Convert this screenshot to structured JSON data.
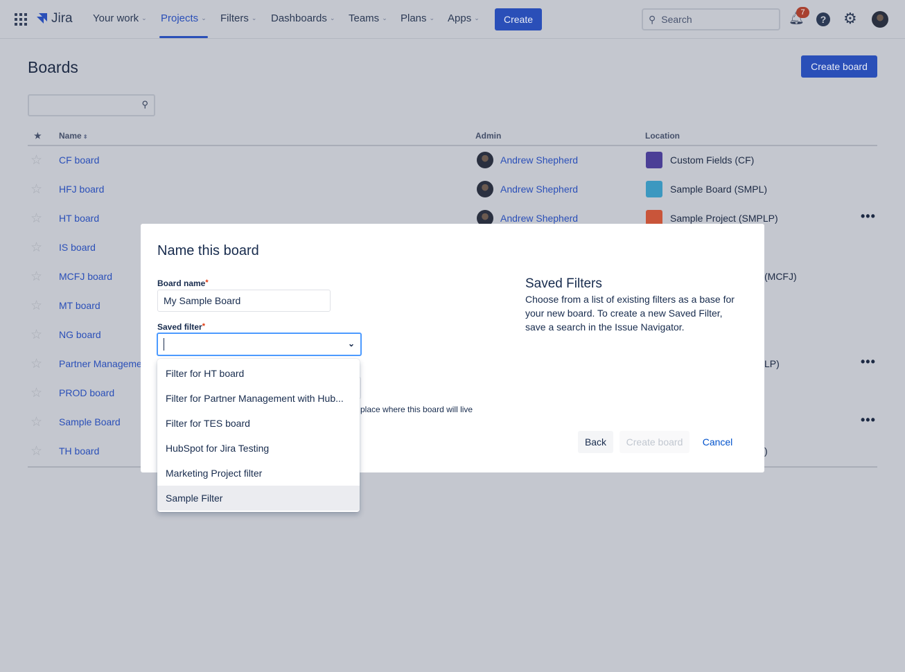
{
  "nav": {
    "app": "Jira",
    "items": [
      {
        "label": "Your work"
      },
      {
        "label": "Projects",
        "active": true
      },
      {
        "label": "Filters"
      },
      {
        "label": "Dashboards"
      },
      {
        "label": "Teams"
      },
      {
        "label": "Plans"
      },
      {
        "label": "Apps"
      }
    ],
    "create": "Create",
    "search_placeholder": "Search",
    "notifications": "7"
  },
  "page": {
    "title": "Boards",
    "create_board": "Create board"
  },
  "table": {
    "headers": {
      "star": "★",
      "name": "Name",
      "admin": "Admin",
      "location": "Location"
    },
    "rows": [
      {
        "name": "CF board",
        "admin": "Andrew Shepherd",
        "location": "Custom Fields (CF)",
        "icon_color": "#4b3f96"
      },
      {
        "name": "HFJ board",
        "admin": "Andrew Shepherd",
        "location": "Sample Board (SMPL)",
        "icon_color": "#3c98c0"
      },
      {
        "name": "HT board",
        "admin": "Andrew Shepherd",
        "location": "Sample Project (SMPLP)",
        "icon_color": "#c9553a",
        "more": true
      },
      {
        "name": "IS board"
      },
      {
        "name": "MCFJ board",
        "location_fragment": "(MCFJ)"
      },
      {
        "name": "MT board"
      },
      {
        "name": "NG board"
      },
      {
        "name": "Partner Manageme",
        "location_fragment": "LP)",
        "more": true
      },
      {
        "name": "PROD board"
      },
      {
        "name": "Sample Board",
        "more": true
      },
      {
        "name": "TH board",
        "location_fragment": ")"
      }
    ]
  },
  "modal": {
    "title": "Name this board",
    "board_name_label": "Board name",
    "board_name_value": "My Sample Board",
    "saved_filter_label": "Saved filter",
    "saved_filter_value": "",
    "location_help": "place where this board will live",
    "side_title": "Saved Filters",
    "side_text": "Choose from a list of existing filters as a base for your new board. To create a new Saved Filter, save a search in the Issue Navigator.",
    "back": "Back",
    "create": "Create board",
    "cancel": "Cancel",
    "options": [
      "Filter for HT board",
      "Filter for Partner Management with Hub...",
      "Filter for TES board",
      "HubSpot for Jira Testing",
      "Marketing Project filter",
      "Sample Filter"
    ],
    "highlighted": "Sample Filter"
  },
  "colors": {
    "accent": "#2a4fb8",
    "focus": "#4c9aff",
    "required": "#de350b"
  }
}
